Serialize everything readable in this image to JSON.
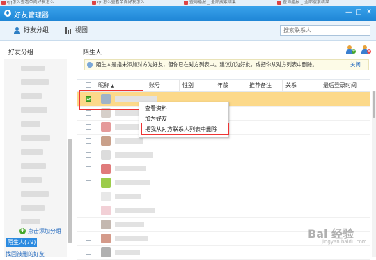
{
  "browser_tabs": [
    {
      "label": "qq怎么查看单向好友怎么..."
    },
    {
      "label": "qq怎么查看单向好友怎么..."
    },
    {
      "label": "查询播报 _ 全部搜索结果"
    },
    {
      "label": "查询播报 _ 全部搜索结果"
    }
  ],
  "window": {
    "title": "好友管理器",
    "min": "—",
    "max": "□",
    "close": "✕"
  },
  "toolbar": {
    "friend_groups": "好友分组",
    "view": "视图",
    "search_placeholder": "搜索联系人"
  },
  "sidebar": {
    "title": "好友分组",
    "add_group": "点击添加分组",
    "stranger": "陌生人(79)",
    "find_deleted": "找回被删的好友"
  },
  "main": {
    "title": "陌生人",
    "info_text": "陌生人是指未添加对方为好友，但你已在对方列表中。建议加为好友，或把你从对方列表中删除。",
    "info_close": "关闭",
    "columns": [
      "昵称",
      "账号",
      "性别",
      "年龄",
      "推荐备注",
      "关系",
      "最后登录时间"
    ],
    "sort_indicator": "▲"
  },
  "context_menu": {
    "items": [
      "查看资料",
      "加为好友",
      "把我从对方联系人列表中删除"
    ]
  },
  "rows": [
    {
      "selected": true,
      "checked": true,
      "avatar_color": "#9fb3c8"
    },
    {
      "selected": false,
      "checked": false,
      "avatar_color": "#d6cfc9"
    },
    {
      "selected": false,
      "checked": false,
      "avatar_color": "#e59a9a"
    },
    {
      "selected": false,
      "checked": false,
      "avatar_color": "#c9a08a"
    },
    {
      "selected": false,
      "checked": false,
      "avatar_color": "#dcdcdc"
    },
    {
      "selected": false,
      "checked": false,
      "avatar_color": "#e07b7b"
    },
    {
      "selected": false,
      "checked": false,
      "avatar_color": "#9ccc4a"
    },
    {
      "selected": false,
      "checked": false,
      "avatar_color": "#e8e8e8"
    },
    {
      "selected": false,
      "checked": false,
      "avatar_color": "#f2d0d6"
    },
    {
      "selected": false,
      "checked": false,
      "avatar_color": "#c4b8b0"
    },
    {
      "selected": false,
      "checked": false,
      "avatar_color": "#d49a8a"
    },
    {
      "selected": false,
      "checked": false,
      "avatar_color": "#b0b0b0"
    }
  ],
  "watermark": {
    "text": "Bai 经验",
    "sub": "jingyan.baidu.com"
  },
  "colors": {
    "title_bar": "#2b92e2",
    "selected_row": "#fcd98a",
    "highlight_box": "#e33333",
    "stranger_active": "#2b8ae0"
  }
}
